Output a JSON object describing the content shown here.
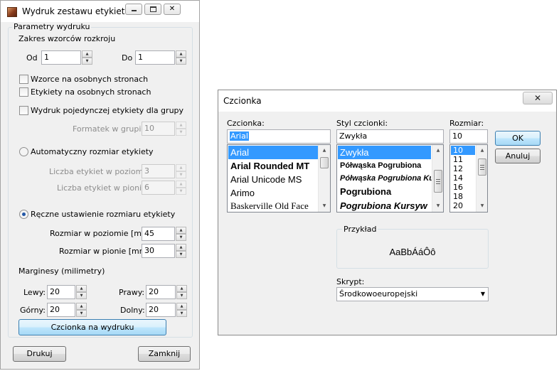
{
  "print_dialog": {
    "title": "Wydruk zestawu etykiet",
    "params_group": "Parametry wydruku",
    "range_label": "Zakres wzorców rozkroju",
    "from_label": "Od",
    "from_value": "1",
    "to_label": "Do",
    "to_value": "1",
    "chk_patterns_separate": "Wzorce na osobnych stronach",
    "chk_labels_separate": "Etykiety na osobnych stronach",
    "chk_single_label": "Wydruk pojedynczej etykiety dla grupy",
    "group_format_label": "Formatek w grupie:",
    "group_format_value": "10",
    "radio_auto": "Automatyczny rozmiar etykiety",
    "h_count_label": "Liczba etykiet w poziomie:",
    "h_count_value": "3",
    "v_count_label": "Liczba etykiet w pionie:",
    "v_count_value": "6",
    "radio_manual": "Ręczne ustawienie rozmiaru etykiety",
    "h_size_label": "Rozmiar w poziomie [mm]:",
    "h_size_value": "45",
    "v_size_label": "Rozmiar w pionie [mm]:",
    "v_size_value": "30",
    "margins_label": "Marginesy (milimetry)",
    "left_label": "Lewy:",
    "left_value": "20",
    "right_label": "Prawy:",
    "right_value": "20",
    "top_label": "Górny:",
    "top_value": "20",
    "bottom_label": "Dolny:",
    "bottom_value": "20",
    "font_button": "Czcionka na wydruku",
    "print_button": "Drukuj",
    "close_button": "Zamknij"
  },
  "font_dialog": {
    "title": "Czcionka",
    "font_label": "Czcionka:",
    "font_value": "Arial",
    "fonts": [
      "Arial",
      "Arial Rounded MT",
      "Arial Unicode MS",
      "Arimo",
      "Baskerville Old Face"
    ],
    "style_label": "Styl czcionki:",
    "style_value": "Zwykła",
    "styles": [
      "Zwykła",
      "Półwąska Pogrubiona",
      "Półwąska Pogrubiona Ku",
      "Pogrubiona",
      "Pogrubiona Kursyw"
    ],
    "size_label": "Rozmiar:",
    "size_value": "10",
    "sizes": [
      "10",
      "11",
      "12",
      "14",
      "16",
      "18",
      "20"
    ],
    "ok_button": "OK",
    "cancel_button": "Anuluj",
    "sample_group": "Przykład",
    "sample_text": "AaBbÁáÔô",
    "script_label": "Skrypt:",
    "script_value": "Środkowoeuropejski",
    "close_glyph": "✕"
  },
  "icons": {
    "minimize": "minimize-icon",
    "maximize": "maximize-icon",
    "close": "close-icon",
    "spin_up": "▲",
    "spin_down": "▼",
    "dropdown": "▼"
  },
  "colors": {
    "selection": "#3399ff",
    "default_button": "#3c7fb1",
    "radio_dot": "#2257a6"
  }
}
